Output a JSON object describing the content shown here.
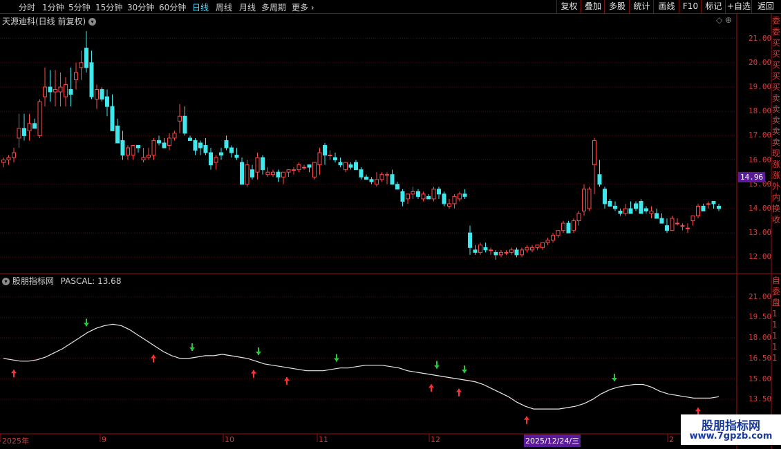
{
  "toolbar": {
    "timeframes": [
      "分时",
      "1分钟",
      "5分钟",
      "15分钟",
      "30分钟",
      "60分钟",
      "日线",
      "周线",
      "月线",
      "多周期",
      "更多"
    ],
    "active_timeframe": "日线",
    "right_buttons": [
      "复权",
      "叠加",
      "多股",
      "统计",
      "画线",
      "F10",
      "标记",
      "+自选",
      "返回"
    ]
  },
  "main_panel": {
    "title": "天源迪科(日线 前复权)",
    "current_price": "14.96",
    "y_labels": [
      "21.00",
      "20.00",
      "19.00",
      "18.00",
      "17.00",
      "16.00",
      "15.00",
      "14.00",
      "13.00",
      "12.00"
    ]
  },
  "indicator_panel": {
    "title": "股朋指标网",
    "indicator_label": "PASCAL: 13.68",
    "y_labels": [
      "21.00",
      "19.50",
      "18.00",
      "16.50",
      "15.00",
      "13.50"
    ]
  },
  "x_axis": {
    "labels": [
      "2025年",
      "9",
      "10",
      "11",
      "12",
      "2"
    ],
    "cursor_date": "2025/12/24/三"
  },
  "right_strip": {
    "top_chars": [
      "委",
      "委",
      "买",
      "买",
      "买",
      "买",
      "买",
      "卖",
      "卖",
      "卖",
      "卖",
      "卖",
      "现",
      "涨",
      "涨",
      "外",
      "内",
      "换",
      "收"
    ],
    "bottom_chars": [
      "自",
      "委",
      "盘",
      "1",
      "1",
      "1",
      "1",
      "1"
    ]
  },
  "watermark": {
    "brand": "股朋指标网",
    "url": "www.7gpzb.com"
  },
  "colors": {
    "up": "#ff4a4a",
    "down": "#3ee8ec",
    "grid": "#5a0a0a",
    "line": "#e8e8e8",
    "arrow_buy": "#ff3030",
    "arrow_sell": "#22cc33",
    "price_box": "#5a1a9a"
  },
  "chart_data": [
    {
      "type": "candlestick",
      "title": "天源迪科(日线 前复权)",
      "ylim": [
        11.5,
        21.5
      ],
      "candles": [
        [
          15.9,
          16.1,
          15.7,
          16.0
        ],
        [
          16.0,
          16.2,
          15.8,
          16.1
        ],
        [
          16.1,
          16.5,
          15.9,
          16.3
        ],
        [
          16.9,
          17.9,
          16.5,
          17.3
        ],
        [
          17.3,
          17.9,
          16.8,
          17.0
        ],
        [
          17.2,
          17.9,
          16.8,
          17.5
        ],
        [
          17.5,
          17.7,
          17.3,
          17.3
        ],
        [
          17.0,
          18.5,
          16.9,
          18.4
        ],
        [
          18.6,
          19.8,
          18.2,
          19.0
        ],
        [
          19.0,
          19.7,
          18.4,
          18.8
        ],
        [
          18.8,
          19.7,
          18.2,
          18.9
        ],
        [
          18.8,
          19.6,
          18.2,
          19.0
        ],
        [
          18.6,
          19.4,
          18.2,
          19.1
        ],
        [
          18.9,
          19.8,
          18.2,
          18.7
        ],
        [
          19.3,
          20.0,
          18.9,
          19.6
        ],
        [
          19.8,
          20.5,
          19.3,
          20.0
        ],
        [
          20.6,
          21.3,
          19.6,
          19.8
        ],
        [
          20.0,
          20.5,
          18.5,
          18.6
        ],
        [
          18.5,
          19.1,
          18.1,
          18.9
        ],
        [
          18.9,
          19.0,
          18.4,
          18.5
        ],
        [
          18.6,
          18.9,
          17.8,
          18.2
        ],
        [
          18.2,
          18.7,
          17.7,
          17.2
        ],
        [
          17.4,
          17.7,
          16.8,
          16.7
        ],
        [
          16.8,
          17.2,
          16.0,
          16.2
        ],
        [
          16.2,
          16.6,
          16.0,
          16.5
        ],
        [
          16.2,
          16.6,
          16.0,
          16.6
        ],
        [
          16.6,
          16.6,
          16.3,
          16.5
        ],
        [
          16.0,
          16.5,
          15.9,
          16.1
        ],
        [
          16.1,
          16.5,
          16.0,
          16.2
        ],
        [
          16.2,
          16.9,
          16.0,
          16.8
        ],
        [
          16.8,
          17.0,
          16.6,
          16.7
        ],
        [
          16.7,
          16.9,
          16.5,
          16.5
        ],
        [
          16.6,
          17.1,
          16.4,
          16.9
        ],
        [
          16.9,
          17.2,
          16.8,
          17.1
        ],
        [
          17.6,
          18.3,
          17.1,
          17.8
        ],
        [
          17.8,
          18.2,
          17.0,
          17.1
        ],
        [
          16.9,
          17.0,
          16.8,
          16.8
        ],
        [
          16.8,
          16.9,
          16.2,
          16.4
        ],
        [
          16.7,
          16.8,
          16.2,
          16.5
        ],
        [
          16.6,
          16.9,
          16.2,
          16.3
        ],
        [
          16.3,
          16.5,
          15.6,
          15.8
        ],
        [
          15.9,
          16.2,
          15.6,
          16.1
        ],
        [
          16.3,
          16.5,
          16.0,
          16.2
        ],
        [
          16.8,
          17.0,
          16.4,
          16.5
        ],
        [
          16.5,
          16.6,
          16.1,
          16.3
        ],
        [
          16.2,
          16.5,
          16.0,
          16.1
        ],
        [
          15.9,
          16.1,
          15.0,
          15.0
        ],
        [
          15.0,
          16.0,
          14.9,
          15.8
        ],
        [
          15.6,
          15.8,
          15.2,
          15.3
        ],
        [
          15.5,
          16.3,
          15.2,
          16.1
        ],
        [
          16.1,
          16.2,
          15.4,
          15.6
        ],
        [
          15.4,
          15.7,
          15.3,
          15.5
        ],
        [
          15.4,
          15.6,
          15.3,
          15.5
        ],
        [
          15.5,
          15.6,
          15.1,
          15.3
        ],
        [
          15.3,
          15.5,
          15.0,
          15.5
        ],
        [
          15.5,
          15.6,
          15.3,
          15.6
        ],
        [
          15.6,
          15.7,
          15.4,
          15.6
        ],
        [
          15.6,
          15.9,
          15.5,
          15.8
        ],
        [
          15.7,
          15.8,
          15.6,
          15.7
        ],
        [
          15.8,
          15.8,
          15.5,
          15.7
        ],
        [
          15.3,
          15.9,
          15.2,
          15.9
        ],
        [
          15.8,
          16.5,
          15.4,
          16.3
        ],
        [
          16.6,
          16.7,
          15.8,
          16.2
        ],
        [
          16.2,
          16.4,
          16.0,
          16.2
        ],
        [
          16.1,
          16.3,
          15.9,
          16.0
        ],
        [
          15.9,
          16.1,
          15.7,
          15.8
        ],
        [
          15.6,
          15.9,
          15.5,
          15.9
        ],
        [
          15.8,
          15.9,
          15.6,
          15.7
        ],
        [
          15.9,
          16.0,
          15.6,
          15.6
        ],
        [
          15.6,
          15.7,
          15.2,
          15.3
        ],
        [
          15.3,
          15.4,
          15.2,
          15.2
        ],
        [
          15.2,
          15.3,
          15.0,
          15.1
        ],
        [
          15.0,
          15.5,
          14.9,
          15.2
        ],
        [
          15.2,
          15.5,
          15.1,
          15.4
        ],
        [
          15.4,
          15.5,
          15.0,
          15.4
        ],
        [
          15.4,
          15.6,
          15.0,
          15.0
        ],
        [
          15.0,
          15.1,
          14.8,
          14.8
        ],
        [
          14.7,
          14.8,
          14.1,
          14.3
        ],
        [
          14.4,
          14.6,
          14.2,
          14.6
        ],
        [
          14.6,
          14.9,
          14.4,
          14.7
        ],
        [
          14.7,
          14.8,
          14.4,
          14.5
        ],
        [
          14.4,
          14.7,
          14.3,
          14.6
        ],
        [
          14.5,
          14.6,
          14.4,
          14.4
        ],
        [
          14.4,
          14.9,
          14.3,
          14.8
        ],
        [
          14.8,
          14.9,
          14.4,
          14.6
        ],
        [
          14.6,
          14.7,
          14.1,
          14.2
        ],
        [
          14.1,
          14.4,
          14.0,
          14.2
        ],
        [
          14.2,
          14.6,
          14.0,
          14.5
        ],
        [
          14.4,
          14.7,
          14.3,
          14.6
        ],
        [
          14.6,
          14.8,
          14.4,
          14.5
        ],
        [
          13.0,
          13.3,
          12.1,
          12.4
        ],
        [
          12.3,
          12.5,
          12.1,
          12.2
        ],
        [
          12.2,
          12.6,
          12.1,
          12.5
        ],
        [
          12.4,
          12.6,
          12.2,
          12.3
        ],
        [
          12.3,
          12.4,
          12.1,
          12.3
        ],
        [
          12.2,
          12.3,
          11.9,
          12.1
        ],
        [
          12.1,
          12.3,
          12.0,
          12.2
        ],
        [
          12.2,
          12.3,
          12.1,
          12.2
        ],
        [
          12.2,
          12.4,
          12.1,
          12.3
        ],
        [
          12.3,
          12.4,
          12.0,
          12.1
        ],
        [
          12.1,
          12.4,
          12.0,
          12.3
        ],
        [
          12.3,
          12.5,
          12.2,
          12.4
        ],
        [
          12.3,
          12.5,
          12.2,
          12.4
        ],
        [
          12.4,
          12.5,
          12.3,
          12.5
        ],
        [
          12.4,
          12.6,
          12.3,
          12.6
        ],
        [
          12.6,
          12.8,
          12.5,
          12.7
        ],
        [
          12.7,
          13.0,
          12.6,
          12.9
        ],
        [
          12.9,
          13.1,
          12.8,
          13.1
        ],
        [
          13.1,
          13.5,
          13.0,
          13.4
        ],
        [
          13.4,
          13.5,
          13.0,
          13.0
        ],
        [
          13.1,
          13.6,
          13.0,
          13.5
        ],
        [
          13.5,
          13.9,
          13.3,
          13.8
        ],
        [
          13.9,
          15.0,
          13.7,
          14.8
        ],
        [
          14.0,
          14.9,
          13.9,
          14.8
        ],
        [
          15.8,
          16.9,
          14.6,
          16.8
        ],
        [
          15.4,
          16.0,
          14.9,
          15.0
        ],
        [
          14.8,
          14.9,
          14.0,
          14.2
        ],
        [
          14.3,
          14.4,
          14.1,
          14.1
        ],
        [
          14.1,
          14.3,
          13.9,
          14.0
        ],
        [
          13.9,
          14.0,
          13.7,
          13.8
        ],
        [
          13.8,
          14.2,
          13.7,
          14.0
        ],
        [
          14.0,
          14.3,
          13.8,
          13.8
        ],
        [
          14.2,
          14.3,
          13.9,
          14.0
        ],
        [
          14.3,
          14.4,
          13.9,
          13.8
        ],
        [
          14.0,
          14.1,
          13.8,
          13.9
        ],
        [
          13.8,
          14.1,
          13.6,
          13.9
        ],
        [
          13.8,
          14.0,
          13.6,
          13.6
        ],
        [
          13.6,
          13.8,
          13.4,
          13.4
        ],
        [
          13.3,
          13.6,
          13.0,
          13.1
        ],
        [
          13.1,
          13.7,
          13.1,
          13.6
        ],
        [
          13.4,
          13.6,
          13.3,
          13.4
        ],
        [
          13.3,
          13.4,
          13.1,
          13.3
        ],
        [
          13.2,
          13.4,
          13.0,
          13.2
        ],
        [
          13.5,
          13.7,
          13.3,
          13.7
        ],
        [
          13.7,
          14.2,
          13.6,
          14.1
        ],
        [
          14.1,
          14.2,
          13.9,
          13.9
        ],
        [
          14.2,
          14.3,
          14.0,
          14.2
        ],
        [
          14.3,
          14.3,
          14.0,
          14.2
        ],
        [
          14.1,
          14.2,
          13.9,
          14.0
        ]
      ]
    },
    {
      "type": "line",
      "title": "PASCAL",
      "ylim": [
        12.4,
        21.9
      ],
      "series": [
        {
          "name": "PASCAL",
          "values": [
            16.5,
            16.4,
            16.3,
            16.3,
            16.4,
            16.6,
            16.9,
            17.2,
            17.6,
            18.0,
            18.4,
            18.7,
            18.9,
            19.0,
            18.9,
            18.6,
            18.2,
            17.8,
            17.4,
            17.0,
            16.7,
            16.5,
            16.5,
            16.6,
            16.7,
            16.7,
            16.8,
            16.7,
            16.6,
            16.5,
            16.3,
            16.1,
            16.0,
            15.9,
            15.8,
            15.7,
            15.6,
            15.6,
            15.6,
            15.7,
            15.8,
            15.8,
            15.9,
            16.0,
            16.0,
            16.0,
            15.9,
            15.8,
            15.6,
            15.5,
            15.4,
            15.3,
            15.2,
            15.1,
            15.0,
            14.9,
            14.8,
            14.6,
            14.3,
            14.0,
            13.7,
            13.3,
            13.0,
            12.8,
            12.8,
            12.8,
            12.8,
            12.9,
            13.0,
            13.2,
            13.5,
            13.9,
            14.2,
            14.4,
            14.5,
            14.6,
            14.6,
            14.4,
            14.1,
            13.9,
            13.8,
            13.7,
            13.6,
            13.6,
            13.6,
            13.7
          ]
        }
      ],
      "arrows": [
        {
          "x": 20,
          "dir": "up"
        },
        {
          "x": 125,
          "dir": "down"
        },
        {
          "x": 222,
          "dir": "up"
        },
        {
          "x": 278,
          "dir": "down"
        },
        {
          "x": 367,
          "dir": "up"
        },
        {
          "x": 374,
          "dir": "down"
        },
        {
          "x": 415,
          "dir": "up"
        },
        {
          "x": 487,
          "dir": "down"
        },
        {
          "x": 624,
          "dir": "up"
        },
        {
          "x": 632,
          "dir": "down"
        },
        {
          "x": 664,
          "dir": "up"
        },
        {
          "x": 672,
          "dir": "down"
        },
        {
          "x": 762,
          "dir": "up"
        },
        {
          "x": 889,
          "dir": "down"
        },
        {
          "x": 1010,
          "dir": "up"
        }
      ]
    }
  ]
}
